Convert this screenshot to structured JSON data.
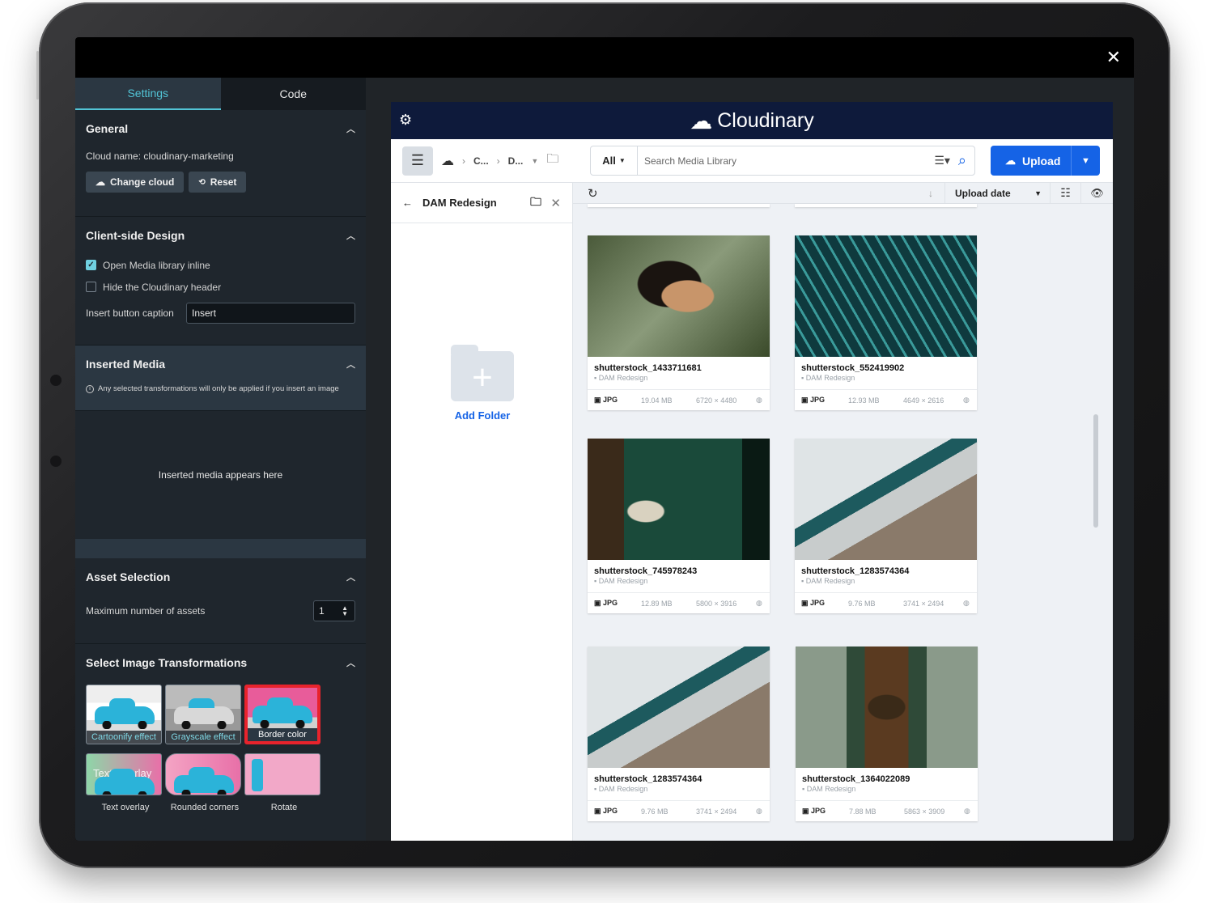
{
  "left_panel": {
    "tabs": [
      {
        "label": "Settings"
      },
      {
        "label": "Code"
      }
    ],
    "general": {
      "title": "General",
      "cloud_name": "Cloud name: cloudinary-marketing",
      "change_cloud": "Change cloud",
      "reset": "Reset"
    },
    "client_design": {
      "title": "Client-side Design",
      "open_inline": "Open Media library inline",
      "open_inline_checked": true,
      "hide_header": "Hide the Cloudinary header",
      "hide_header_checked": false,
      "insert_caption_label": "Insert button caption",
      "insert_caption_value": "Insert"
    },
    "inserted_media": {
      "title": "Inserted Media",
      "note": "Any selected transformations will only be applied if you insert an image",
      "placeholder": "Inserted media appears here"
    },
    "asset_selection": {
      "title": "Asset Selection",
      "max_label": "Maximum number of assets",
      "max_value": "1"
    },
    "transformations": {
      "title": "Select Image Transformations",
      "items": [
        {
          "label": "Cartoonify effect"
        },
        {
          "label": "Grayscale effect"
        },
        {
          "label": "Border color"
        },
        {
          "label": "Text overlay",
          "overlay_text": "Text Overlay"
        },
        {
          "label": "Rounded corners"
        },
        {
          "label": "Rotate"
        }
      ]
    }
  },
  "media_library": {
    "brand": "Cloudinary",
    "breadcrumbs": [
      "C...",
      "D..."
    ],
    "search": {
      "scope": "All",
      "placeholder": "Search Media Library"
    },
    "upload_label": "Upload",
    "folder": {
      "title": "DAM Redesign",
      "add_folder": "Add Folder"
    },
    "sort": {
      "label": "Upload date"
    },
    "assets": [
      {
        "name": "shutterstock_1433711681",
        "folder": "DAM Redesign",
        "format": "JPG",
        "size": "19.04 MB",
        "dims": "6720 × 4480"
      },
      {
        "name": "shutterstock_552419902",
        "folder": "DAM Redesign",
        "format": "JPG",
        "size": "12.93 MB",
        "dims": "4649 × 2616"
      },
      {
        "name": "shutterstock_745978243",
        "folder": "DAM Redesign",
        "format": "JPG",
        "size": "12.89 MB",
        "dims": "5800 × 3916"
      },
      {
        "name": "shutterstock_1283574364",
        "folder": "DAM Redesign",
        "format": "JPG",
        "size": "9.76 MB",
        "dims": "3741 × 2494"
      },
      {
        "name": "shutterstock_1283574364",
        "folder": "DAM Redesign",
        "format": "JPG",
        "size": "9.76 MB",
        "dims": "3741 × 2494"
      },
      {
        "name": "shutterstock_1364022089",
        "folder": "DAM Redesign",
        "format": "JPG",
        "size": "7.88 MB",
        "dims": "5863 × 3909"
      }
    ]
  },
  "colors": {
    "accent": "#1563e6",
    "panel_accent": "#52c4d6",
    "header_bg": "#0e1a3b"
  }
}
